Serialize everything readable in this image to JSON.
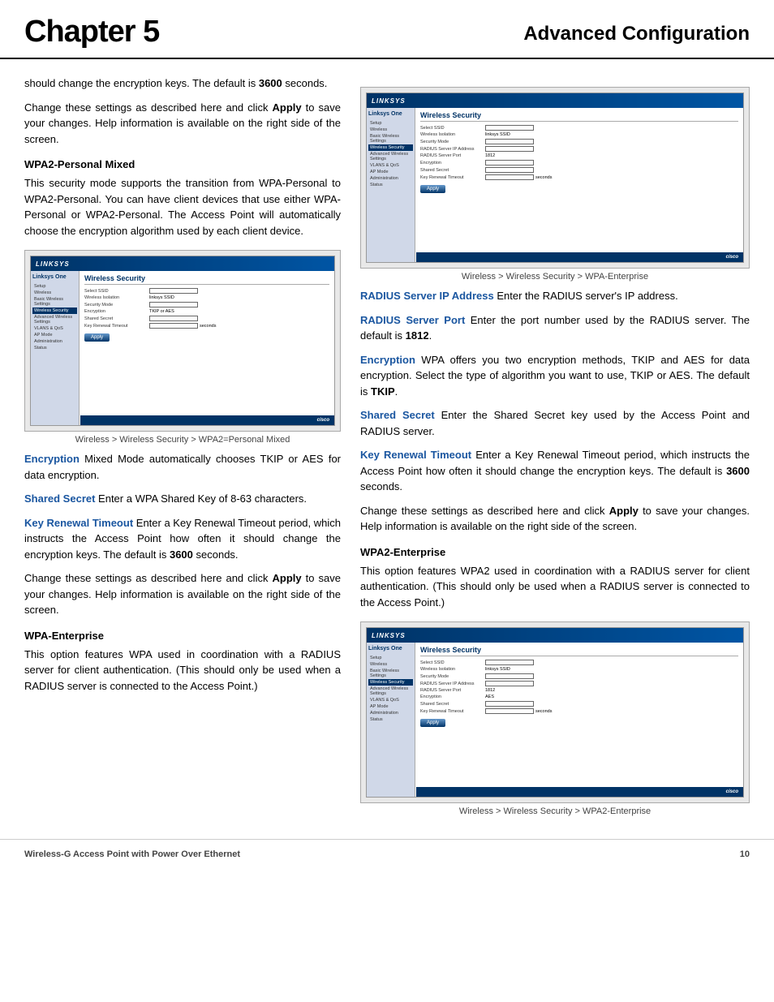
{
  "header": {
    "chapter": "Chapter 5",
    "section": "Advanced Configuration"
  },
  "footer": {
    "left": "Wireless-G Access Point with  Power Over Ethernet",
    "right": "10"
  },
  "left_column": {
    "intro": {
      "text1": "should change the encryption keys. The default is ",
      "bold1": "3600",
      "text2": " seconds.",
      "text3": "Change these settings as described here and click ",
      "bold2": "Apply",
      "text4": " to save your changes. Help information is available on the right side of the screen."
    },
    "wpa2_personal_mixed": {
      "heading": "WPA2-Personal Mixed",
      "body": "This security mode supports the transition from WPA-Personal to WPA2-Personal. You can have client devices that use either WPA-Personal or WPA2-Personal. The Access Point will automatically choose the encryption algorithm used by each client device."
    },
    "screenshot1_caption": "Wireless > Wireless Security > WPA2=Personal Mixed",
    "encryption": {
      "label": "Encryption",
      "body": "Mixed Mode automatically chooses TKIP or AES for data encryption."
    },
    "shared_secret": {
      "label": "Shared Secret",
      "body": "Enter a WPA Shared Key of 8-63 characters."
    },
    "key_renewal": {
      "label": "Key Renewal Timeout",
      "body": "Enter a Key Renewal Timeout period, which instructs the Access Point how often it should change the encryption keys. The default is ",
      "bold": "3600",
      "text2": " seconds."
    },
    "change_settings": {
      "text1": "Change these settings as described here and click ",
      "bold": "Apply",
      "text2": " to save your changes. Help information is available on the right side of the screen."
    },
    "wpa_enterprise": {
      "heading": "WPA-Enterprise",
      "body": "This option features WPA used in coordination with a RADIUS server for client authentication. (This should only be used when a RADIUS server is connected to the Access Point.)"
    }
  },
  "right_column": {
    "screenshot2_caption": "Wireless > Wireless Security > WPA-Enterprise",
    "radius_ip": {
      "label": "RADIUS Server IP Address",
      "body": " Enter the RADIUS server's IP address."
    },
    "radius_port": {
      "label": "RADIUS Server Port",
      "body": " Enter the port number used by the RADIUS server. The default is ",
      "bold": "1812",
      "text2": "."
    },
    "encryption": {
      "label": "Encryption",
      "body": " WPA offers you two encryption methods, TKIP and AES for data encryption. Select the type of algorithm you want to use, TKIP or AES. The default is ",
      "bold": "TKIP",
      "text2": "."
    },
    "shared_secret": {
      "label": "Shared Secret",
      "body": " Enter the Shared Secret key used by the Access Point and RADIUS server."
    },
    "key_renewal": {
      "label": "Key Renewal Timeout",
      "body": " Enter a Key Renewal Timeout period, which instructs the Access Point how often it should change the encryption keys. The default is ",
      "bold": "3600",
      "text2": " seconds."
    },
    "change_settings": {
      "text1": "Change these settings as described here and click ",
      "bold": "Apply",
      "text2": " to save your changes. Help information is available on the right side of the screen."
    },
    "wpa2_enterprise": {
      "heading": "WPA2-Enterprise",
      "body": "This option features WPA2 used in coordination with a RADIUS server for client authentication. (This should only be used when a RADIUS server is connected to the Access Point.)"
    },
    "screenshot3_caption": "Wireless > Wireless Security > WPA2-Enterprise"
  },
  "linksys_ui": {
    "brand": "Linksys One",
    "tab_title": "Wireless Security",
    "sidebar_items": [
      "Setup",
      "Wireless",
      "Basic Wireless Settings",
      "Wireless Security",
      "Advanced Wireless Settings",
      "VLANS & QoS",
      "AP Mode",
      "Administration",
      "Status"
    ],
    "apply_button": "Apply"
  }
}
